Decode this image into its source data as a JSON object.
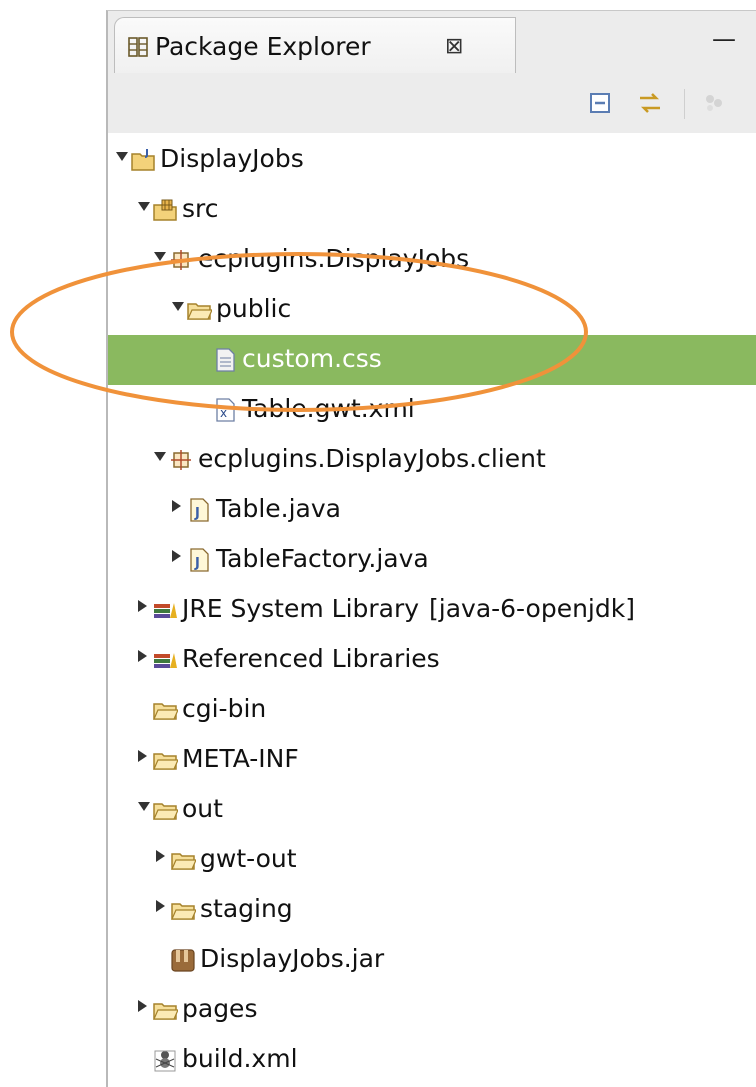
{
  "view": {
    "title": "Package Explorer",
    "close_glyph": "⊠",
    "minimize_glyph": "—"
  },
  "tree": {
    "items": [
      {
        "label": "DisplayJobs",
        "icon": "java-project-icon",
        "expanded": true
      },
      {
        "label": "src",
        "icon": "source-folder-icon",
        "expanded": true
      },
      {
        "label": "ecplugins.DisplayJobs",
        "icon": "package-icon",
        "expanded": true
      },
      {
        "label": "public",
        "icon": "folder-icon",
        "expanded": true
      },
      {
        "label": "custom.css",
        "icon": "css-file-icon",
        "selected": true
      },
      {
        "label": "Table.gwt.xml",
        "icon": "xml-file-icon"
      },
      {
        "label": "ecplugins.DisplayJobs.client",
        "icon": "package-icon",
        "expanded": true
      },
      {
        "label": "Table.java",
        "icon": "java-file-icon",
        "expanded": false
      },
      {
        "label": "TableFactory.java",
        "icon": "java-file-icon",
        "expanded": false
      },
      {
        "label": "JRE System Library",
        "decoration": "[java-6-openjdk]",
        "icon": "library-icon",
        "expanded": false
      },
      {
        "label": "Referenced Libraries",
        "icon": "library-icon",
        "expanded": false
      },
      {
        "label": "cgi-bin",
        "icon": "folder-icon"
      },
      {
        "label": "META-INF",
        "icon": "folder-icon",
        "expanded": false
      },
      {
        "label": "out",
        "icon": "folder-icon",
        "expanded": true
      },
      {
        "label": "gwt-out",
        "icon": "folder-icon",
        "expanded": false
      },
      {
        "label": "staging",
        "icon": "folder-icon",
        "expanded": false
      },
      {
        "label": "DisplayJobs.jar",
        "icon": "jar-file-icon"
      },
      {
        "label": "pages",
        "icon": "folder-icon",
        "expanded": false
      },
      {
        "label": "build.xml",
        "icon": "ant-file-icon"
      }
    ]
  },
  "colors": {
    "selection": "#8ab95f",
    "annotation_ellipse": "#f0923a",
    "decoration_text": "#b8984b"
  }
}
